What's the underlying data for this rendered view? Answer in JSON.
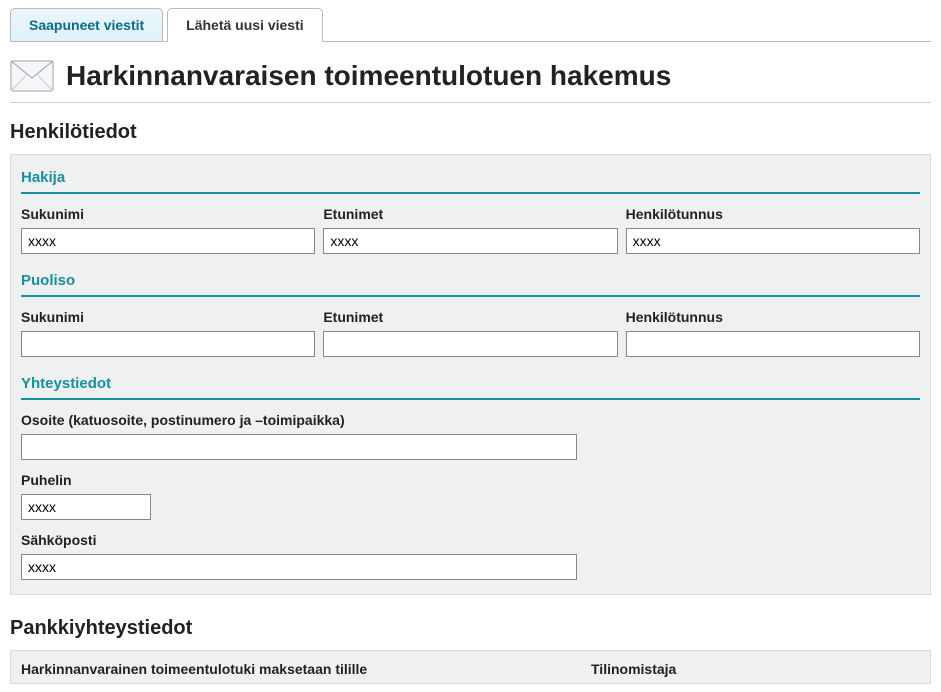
{
  "tabs": {
    "inbox": "Saapuneet viestit",
    "compose": "Lähetä uusi viesti"
  },
  "page_title": "Harkinnanvaraisen toimeentulotuen hakemus",
  "sections": {
    "person": {
      "heading": "Henkilötiedot",
      "applicant": {
        "title": "Hakija",
        "lastname_label": "Sukunimi",
        "lastname_value": "xxxx",
        "firstnames_label": "Etunimet",
        "firstnames_value": "xxxx",
        "ssn_label": "Henkilötunnus",
        "ssn_value": "xxxx"
      },
      "spouse": {
        "title": "Puoliso",
        "lastname_label": "Sukunimi",
        "lastname_value": "",
        "firstnames_label": "Etunimet",
        "firstnames_value": "",
        "ssn_label": "Henkilötunnus",
        "ssn_value": ""
      },
      "contact": {
        "title": "Yhteystiedot",
        "address_label": "Osoite (katuosoite, postinumero ja –toimipaikka)",
        "address_value": "",
        "phone_label": "Puhelin",
        "phone_value": "xxxx",
        "email_label": "Sähköposti",
        "email_value": "xxxx"
      }
    },
    "bank": {
      "heading": "Pankkiyhteystiedot",
      "account_label": "Harkinnanvarainen toimeentulotuki maksetaan tilille",
      "owner_label": "Tilinomistaja"
    }
  }
}
